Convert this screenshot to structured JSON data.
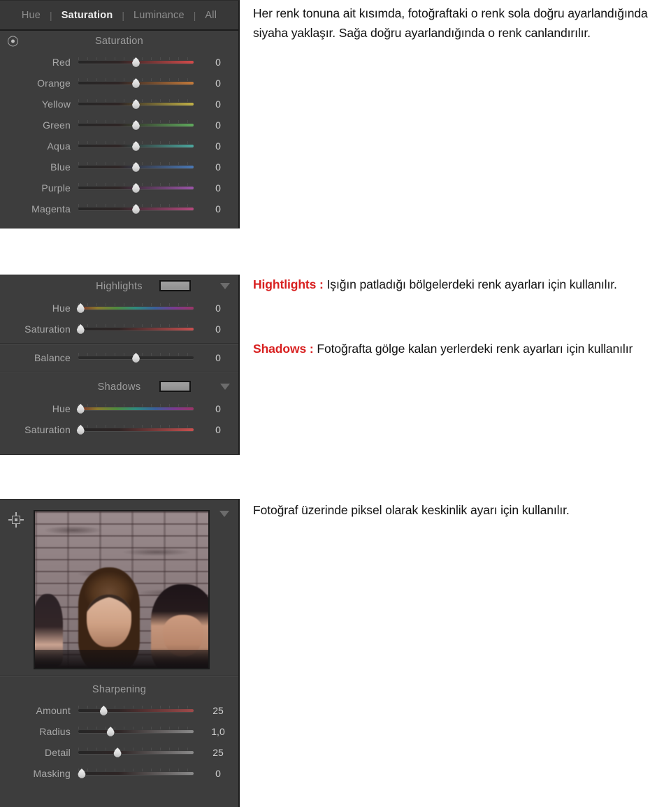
{
  "document": {
    "paragraphs": {
      "intro": "Her renk tonuna ait kısımda, fotoğraftaki o renk sola doğru ayarlandığında siyaha yaklaşır. Sağa doğru ayarlandığında o renk canlandırılır.",
      "highlights_term": "Hightlights :",
      "highlights_body": " Işığın patladığı bölgelerdeki renk ayarları için kullanılır.",
      "shadows_term": "Shadows :",
      "shadows_body": " Fotoğrafta gölge kalan yerlerdeki renk ayarları için kullanılır",
      "sharpening_note": "Fotoğraf üzerinde piksel olarak keskinlik ayarı için kullanılır."
    },
    "accent_color": "#d81f1f"
  },
  "hsl_panel": {
    "tabs": [
      {
        "label": "Hue",
        "active": false
      },
      {
        "label": "Saturation",
        "active": true
      },
      {
        "label": "Luminance",
        "active": false
      },
      {
        "label": "All",
        "active": false
      }
    ],
    "tab_separator": "|",
    "target_icon": "target-adjust-icon",
    "section_title": "Saturation",
    "sliders": [
      {
        "label": "Red",
        "value": "0",
        "pos": 50,
        "color": "#d24a4a"
      },
      {
        "label": "Orange",
        "value": "0",
        "pos": 50,
        "color": "#c2793a"
      },
      {
        "label": "Yellow",
        "value": "0",
        "pos": 50,
        "color": "#c0b046"
      },
      {
        "label": "Green",
        "value": "0",
        "pos": 50,
        "color": "#5fa95c"
      },
      {
        "label": "Aqua",
        "value": "0",
        "pos": 50,
        "color": "#4ba79e"
      },
      {
        "label": "Blue",
        "value": "0",
        "pos": 50,
        "color": "#4a78b5"
      },
      {
        "label": "Purple",
        "value": "0",
        "pos": 50,
        "color": "#9a55a8"
      },
      {
        "label": "Magenta",
        "value": "0",
        "pos": 50,
        "color": "#b4497e"
      }
    ]
  },
  "split_tone_panel": {
    "highlights": {
      "title": "Highlights",
      "swatch_color": "#979797",
      "caret": "chevron-down-icon",
      "sliders": [
        {
          "label": "Hue",
          "value": "0",
          "pos": 2,
          "type": "hue"
        },
        {
          "label": "Saturation",
          "value": "0",
          "pos": 2,
          "color": "#c9504f"
        }
      ]
    },
    "balance": {
      "label": "Balance",
      "value": "0",
      "pos": 50
    },
    "shadows": {
      "title": "Shadows",
      "swatch_color": "#979797",
      "caret": "chevron-down-icon",
      "sliders": [
        {
          "label": "Hue",
          "value": "0",
          "pos": 2,
          "type": "hue"
        },
        {
          "label": "Saturation",
          "value": "0",
          "pos": 2,
          "color": "#c9504f"
        }
      ]
    }
  },
  "detail_panel": {
    "crosshair_icon": "crosshair-target-icon",
    "caret": "chevron-down-icon",
    "preview_alt": "sharpening-preview-thumbnail",
    "section_title": "Sharpening",
    "sliders": [
      {
        "label": "Amount",
        "value": "25",
        "pos": 22,
        "color": "#a04a4a"
      },
      {
        "label": "Radius",
        "value": "1,0",
        "pos": 28,
        "color": "#8a8a8a"
      },
      {
        "label": "Detail",
        "value": "25",
        "pos": 34,
        "color": "#8a8a8a"
      },
      {
        "label": "Masking",
        "value": "0",
        "pos": 3,
        "color": "#8a8a8a"
      }
    ]
  }
}
